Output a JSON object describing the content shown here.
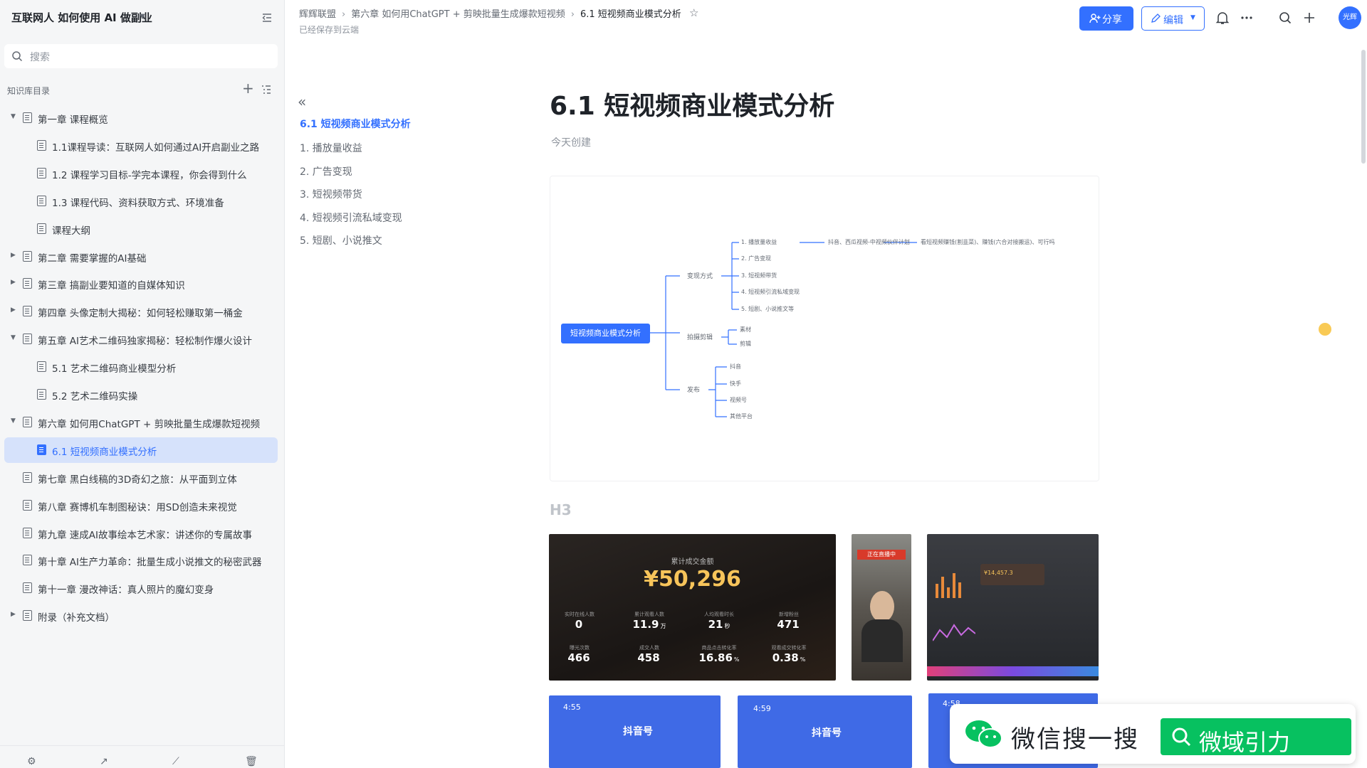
{
  "sidebar": {
    "workspace_title": "互联网人 如何使用 AI 做副业",
    "search_placeholder": "搜索",
    "tree_heading": "知识库目录",
    "items": [
      {
        "label": "第一章 课程概览",
        "level": 0,
        "expanded": true
      },
      {
        "label": "1.1课程导读：互联网人如何通过AI开启副业之路",
        "level": 1
      },
      {
        "label": "1.2 课程学习目标-学完本课程，你会得到什么",
        "level": 1
      },
      {
        "label": "1.3 课程代码、资料获取方式、环境准备",
        "level": 1
      },
      {
        "label": "课程大纲",
        "level": 1
      },
      {
        "label": "第二章 需要掌握的AI基础",
        "level": 0,
        "expanded": false
      },
      {
        "label": "第三章 搞副业要知道的自媒体知识",
        "level": 0,
        "expanded": false
      },
      {
        "label": "第四章 头像定制大揭秘：如何轻松赚取第一桶金",
        "level": 0,
        "expanded": false
      },
      {
        "label": "第五章 AI艺术二维码独家揭秘：轻松制作爆火设计",
        "level": 0,
        "expanded": true
      },
      {
        "label": "5.1 艺术二维码商业模型分析",
        "level": 1
      },
      {
        "label": "5.2 艺术二维码实操",
        "level": 1
      },
      {
        "label": "第六章 如何用ChatGPT + 剪映批量生成爆款短视频",
        "level": 0,
        "expanded": true
      },
      {
        "label": "6.1 短视频商业模式分析",
        "level": 1,
        "active": true
      },
      {
        "label": "第七章 黑白线稿的3D奇幻之旅：从平面到立体",
        "level": 0
      },
      {
        "label": "第八章 赛博机车制图秘诀：用SD创造未来视觉",
        "level": 0
      },
      {
        "label": "第九章 速成AI故事绘本艺术家：讲述你的专属故事",
        "level": 0
      },
      {
        "label": "第十章 AI生产力革命：批量生成小说推文的秘密武器",
        "level": 0
      },
      {
        "label": "第十一章 漫改神话：真人照片的魔幻变身",
        "level": 0
      },
      {
        "label": "附录（补充文档）",
        "level": 0,
        "expanded": false
      }
    ]
  },
  "header": {
    "breadcrumb": [
      "辉辉联盟",
      "第六章 如何用ChatGPT + 剪映批量生成爆款短视频",
      "6.1 短视频商业模式分析"
    ],
    "save_status": "已经保存到云端",
    "share_label": "分享",
    "edit_label": "编辑",
    "avatar_text": "光辉"
  },
  "toc": {
    "items": [
      {
        "label": "6.1 短视频商业模式分析",
        "active": true
      },
      {
        "label": "1. 播放量收益"
      },
      {
        "label": "2. 广告变现"
      },
      {
        "label": "3. 短视频带货"
      },
      {
        "label": "4. 短视频引流私域变现"
      },
      {
        "label": "5. 短剧、小说推文"
      }
    ]
  },
  "doc": {
    "title": "6.1 短视频商业模式分析",
    "meta": "今天创建",
    "h3_placeholder": "H3",
    "mindmap": {
      "root": "短视频商业模式分析",
      "branches": [
        {
          "label": "变现方式",
          "children": [
            "1. 播放量收益",
            "2. 广告变现",
            "3. 短视频带货",
            "4. 短视频引流私域变现",
            "5. 短剧、小说推文等"
          ]
        },
        {
          "label": "拍摄剪辑",
          "children": [
            "素材",
            "剪辑"
          ]
        },
        {
          "label": "发布",
          "children": [
            "抖音",
            "快手",
            "视频号",
            "其他平台"
          ]
        }
      ],
      "detail_1": "抖音、西瓜视频-中视频伙伴计划",
      "detail_2": "看短视频赚钱(割韭菜)、赚钱(六合对接搬运)、可行吗"
    },
    "stats_panel": {
      "heading": "累计成交金额",
      "amount": "¥50,296",
      "cells": [
        {
          "label": "实时在线人数",
          "value": "0",
          "unit": ""
        },
        {
          "label": "累计观看人数",
          "value": "11.9",
          "unit": "万"
        },
        {
          "label": "人均观看时长",
          "value": "21",
          "unit": "秒"
        },
        {
          "label": "新增粉丝",
          "value": "471",
          "unit": ""
        },
        {
          "label": "曝光次数",
          "value": "466",
          "unit": ""
        },
        {
          "label": "成交人数",
          "value": "458",
          "unit": ""
        },
        {
          "label": "商品点击转化率",
          "value": "16.86",
          "unit": "%"
        },
        {
          "label": "观看成交转化率",
          "value": "0.38",
          "unit": "%"
        }
      ]
    },
    "phone_shots": [
      {
        "time": "4:55",
        "app": "抖音号"
      },
      {
        "time": "4:59",
        "app": "抖音号"
      },
      {
        "time": "4:58",
        "app": ""
      }
    ],
    "dashboard_value": "¥14,457.3",
    "live_banner": "正在直播中"
  },
  "watermark": {
    "text": "微信搜一搜",
    "button": "微域引力"
  },
  "colors": {
    "accent": "#3370ff",
    "sidebar_bg": "#f5f6f7",
    "active_bg": "#d6e2fb",
    "wechat_green": "#07c160"
  }
}
